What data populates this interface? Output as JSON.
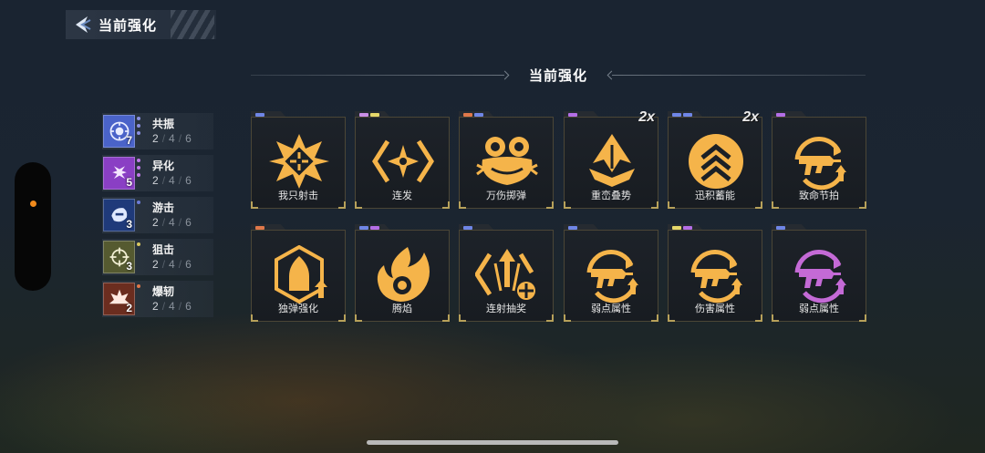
{
  "header": {
    "title": "当前强化",
    "back_icon": "back-arrow-icon"
  },
  "section": {
    "title": "当前强化"
  },
  "categories": [
    {
      "name": "共振",
      "level": "7",
      "current": "2",
      "mid": "4",
      "max": "6",
      "progress_text": [
        "2",
        "4",
        "6"
      ],
      "color": "#4a63c9",
      "dots": [
        "#8a8fe0",
        "#8a8fe0",
        "#8a8fe0"
      ],
      "icon": "resonance-icon"
    },
    {
      "name": "异化",
      "level": "5",
      "current": "2",
      "mid": "4",
      "max": "6",
      "progress_text": [
        "2",
        "4",
        "6"
      ],
      "color": "#8a3fc4",
      "dots": [
        "#c07ae8",
        "#c07ae8",
        "#c07ae8"
      ],
      "icon": "mutation-icon"
    },
    {
      "name": "游击",
      "level": "3",
      "current": "2",
      "mid": "4",
      "max": "6",
      "progress_text": [
        "2",
        "4",
        "6"
      ],
      "color": "#1f3a7a",
      "dots": [
        "#6c7cd8"
      ],
      "icon": "guerrilla-icon"
    },
    {
      "name": "狙击",
      "level": "3",
      "current": "2",
      "mid": "4",
      "max": "6",
      "progress_text": [
        "2",
        "4",
        "6"
      ],
      "color": "#555a30",
      "dots": [
        "#d8c860"
      ],
      "icon": "sniper-icon"
    },
    {
      "name": "爆轫",
      "level": "2",
      "current": "2",
      "mid": "4",
      "max": "6",
      "progress_text": [
        "2",
        "4",
        "6"
      ],
      "color": "#6b2d1f",
      "dots": [
        "#e0784a"
      ],
      "icon": "blast-icon"
    }
  ],
  "cards": [
    {
      "label": "我只射击",
      "icon": "crosshair-burst-icon",
      "tab_colors": [
        "#6f86e6"
      ],
      "multiplier": ""
    },
    {
      "label": "连发",
      "icon": "rapid-fire-star-icon",
      "tab_colors": [
        "#c98ee6",
        "#e6d86a"
      ],
      "multiplier": ""
    },
    {
      "label": "万伤掷弹",
      "icon": "grenade-icon",
      "tab_colors": [
        "#e0784a",
        "#6f86e6"
      ],
      "multiplier": ""
    },
    {
      "label": "重峦叠势",
      "icon": "mountain-arrow-icon",
      "tab_colors": [
        "#b46ee6"
      ],
      "multiplier": "2x"
    },
    {
      "label": "迅积蓄能",
      "icon": "chevron-charge-icon",
      "tab_colors": [
        "#6f86e6",
        "#6f86e6"
      ],
      "multiplier": "2x"
    },
    {
      "label": "致命节拍",
      "icon": "smg-upgrade-icon",
      "tab_colors": [
        "#b46ee6"
      ],
      "multiplier": ""
    },
    {
      "label": "独弹强化",
      "icon": "bullet-upgrade-icon",
      "tab_colors": [
        "#e0784a"
      ],
      "multiplier": ""
    },
    {
      "label": "腾焰",
      "icon": "flame-icon",
      "tab_colors": [
        "#6f86e6",
        "#b46ee6"
      ],
      "multiplier": ""
    },
    {
      "label": "连射抽奖",
      "icon": "lottery-arrows-icon",
      "tab_colors": [
        "#6f86e6"
      ],
      "multiplier": ""
    },
    {
      "label": "弱点属性",
      "icon": "smg-upgrade-icon",
      "tab_colors": [
        "#6f86e6"
      ],
      "multiplier": ""
    },
    {
      "label": "伤害属性",
      "icon": "smg-upgrade-icon",
      "tab_colors": [
        "#e6d86a",
        "#b46ee6"
      ],
      "multiplier": ""
    },
    {
      "label": "弱点属性",
      "icon": "smg-upgrade-purple-icon",
      "tab_colors": [
        "#6f86e6"
      ],
      "multiplier": ""
    }
  ],
  "colors": {
    "gold": "#f5b44a",
    "purple": "#c46ad6",
    "accent_orange": "#f08a1c"
  }
}
